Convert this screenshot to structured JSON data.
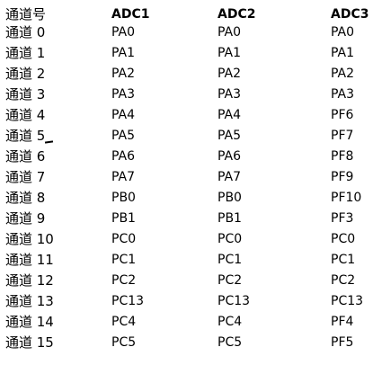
{
  "header": {
    "channel": "通道号",
    "adc1": "ADC1",
    "adc2": "ADC2",
    "adc3": "ADC3"
  },
  "rows": [
    {
      "channel": "通道 0",
      "adc1": "PA0",
      "adc2": "PA0",
      "adc3": "PA0"
    },
    {
      "channel": "通道 1",
      "adc1": "PA1",
      "adc2": "PA1",
      "adc3": "PA1"
    },
    {
      "channel": "通道 2",
      "adc1": "PA2",
      "adc2": "PA2",
      "adc3": "PA2"
    },
    {
      "channel": "通道 3",
      "adc1": "PA3",
      "adc2": "PA3",
      "adc3": "PA3"
    },
    {
      "channel": "通道 4",
      "adc1": "PA4",
      "adc2": "PA4",
      "adc3": "PF6"
    },
    {
      "channel": "通道 5",
      "adc1": "PA5",
      "adc2": "PA5",
      "adc3": "PF7"
    },
    {
      "channel": "通道 6",
      "adc1": "PA6",
      "adc2": "PA6",
      "adc3": "PF8"
    },
    {
      "channel": "通道 7",
      "adc1": "PA7",
      "adc2": "PA7",
      "adc3": "PF9"
    },
    {
      "channel": "通道 8",
      "adc1": "PB0",
      "adc2": "PB0",
      "adc3": "PF10"
    },
    {
      "channel": "通道 9",
      "adc1": "PB1",
      "adc2": "PB1",
      "adc3": "PF3"
    },
    {
      "channel": "通道 10",
      "adc1": "PC0",
      "adc2": "PC0",
      "adc3": "PC0"
    },
    {
      "channel": "通道 11",
      "adc1": "PC1",
      "adc2": "PC1",
      "adc3": "PC1"
    },
    {
      "channel": "通道 12",
      "adc1": "PC2",
      "adc2": "PC2",
      "adc3": "PC2"
    },
    {
      "channel": "通道 13",
      "adc1": "PC13",
      "adc2": "PC13",
      "adc3": "PC13"
    },
    {
      "channel": "通道 14",
      "adc1": "PC4",
      "adc2": "PC4",
      "adc3": "PF4"
    },
    {
      "channel": "通道 15",
      "adc1": "PC5",
      "adc2": "PC5",
      "adc3": "PF5"
    }
  ]
}
